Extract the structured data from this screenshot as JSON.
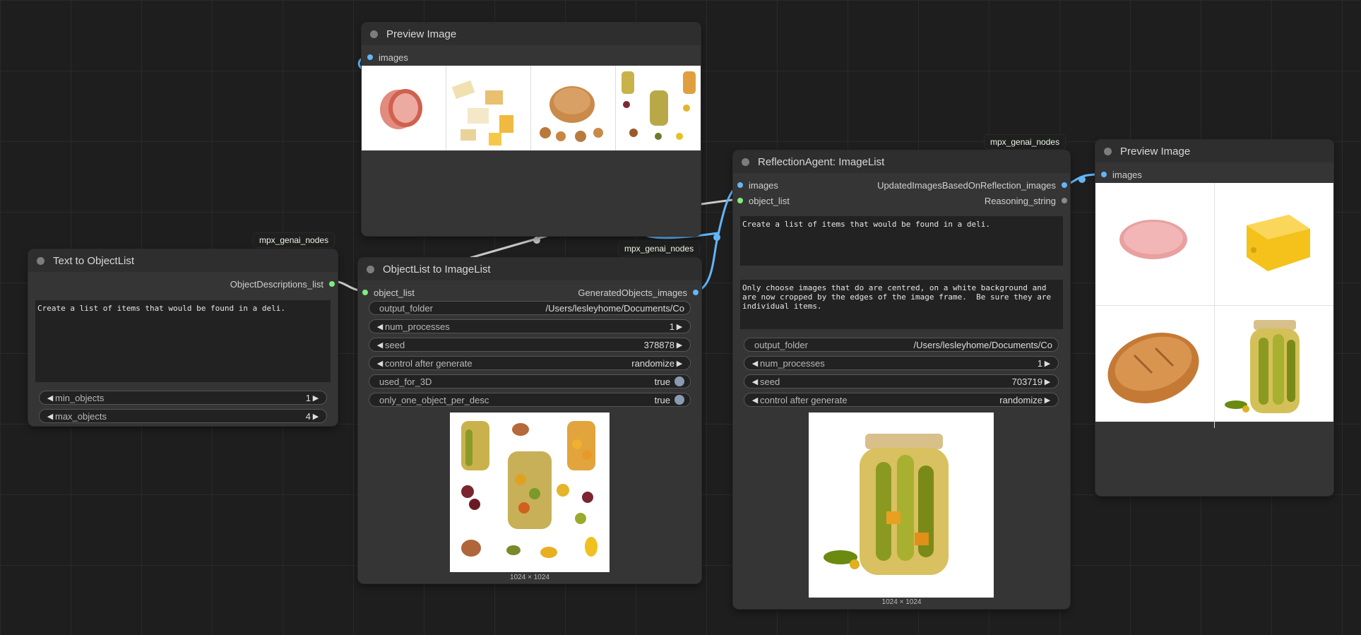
{
  "tags": {
    "t1": "mpx_genai_nodes",
    "t2": "mpx_genai_nodes",
    "t3": "mpx_genai_nodes"
  },
  "preview_top": {
    "title": "Preview Image",
    "input_images": "images"
  },
  "text_to_objectlist": {
    "title": "Text to ObjectList",
    "output": "ObjectDescriptionsList",
    "output_label": "ObjectDescriptions_list",
    "prompt": "Create a list of items that would be found in a deli.",
    "min_objects_label": "min_objects",
    "min_objects": "1",
    "max_objects_label": "max_objects",
    "max_objects": "4"
  },
  "objectlist_to_imagelist": {
    "title": "ObjectList to ImageList",
    "input": "object_list",
    "output": "GeneratedObjects_images",
    "output_folder_label": "output_folder",
    "output_folder": "/Users/lesleyhome/Documents/Co",
    "num_processes_label": "num_processes",
    "num_processes": "1",
    "seed_label": "seed",
    "seed": "378878",
    "control_label": "control after generate",
    "control": "randomize",
    "used_for_3d_label": "used_for_3D",
    "used_for_3d": "true",
    "one_object_label": "only_one_object_per_desc",
    "one_object": "true",
    "image_size": "1024 × 1024"
  },
  "reflection_agent": {
    "title": "ReflectionAgent: ImageList",
    "input_images": "images",
    "input_object_list": "object_list",
    "output_images": "UpdatedImagesBasedOnReflection_images",
    "output_reasoning": "Reasoning_string",
    "prompt1": "Create a list of items that would be found in a deli.",
    "prompt2": "Only choose images that do are centred, on a white background and are now cropped by the edges of the image frame.  Be sure they are individual items.",
    "output_folder_label": "output_folder",
    "output_folder": "/Users/lesleyhome/Documents/Co",
    "num_processes_label": "num_processes",
    "num_processes": "1",
    "seed_label": "seed",
    "seed": "703719",
    "control_label": "control after generate",
    "control": "randomize",
    "image_size": "1024 × 1024"
  },
  "preview_right": {
    "title": "Preview Image",
    "input_images": "images"
  },
  "colors": {
    "canvas": "#1e1e1e",
    "node": "#353535",
    "pin_blue": "#64b5f6",
    "pin_green": "#7cf07c"
  }
}
